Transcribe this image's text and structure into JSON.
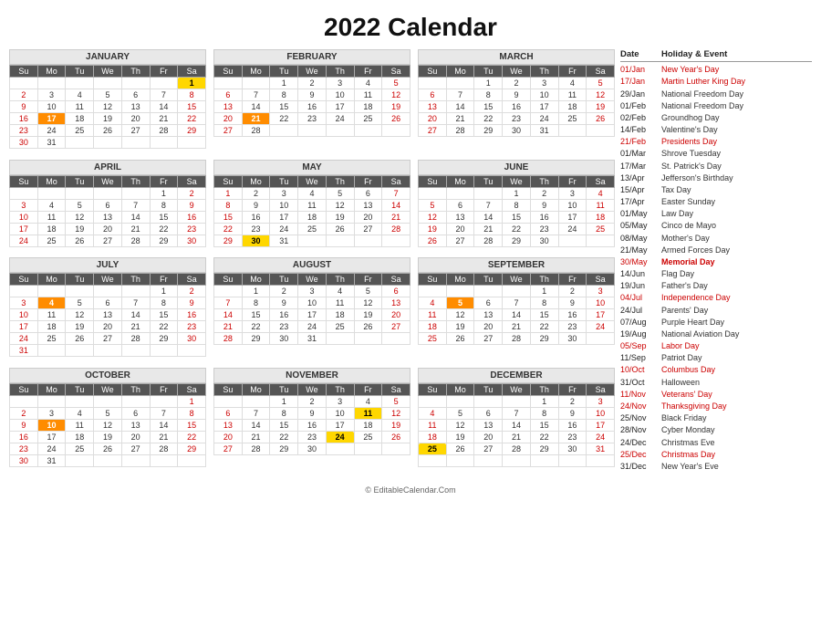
{
  "title": "2022 Calendar",
  "months": [
    {
      "name": "JANUARY",
      "headers": [
        "Su",
        "Mo",
        "Tu",
        "We",
        "Th",
        "Fr",
        "Sa"
      ],
      "weeks": [
        [
          null,
          null,
          null,
          null,
          null,
          null,
          "1h"
        ],
        [
          "2",
          "3",
          "4",
          "5",
          "6",
          "7",
          "8s"
        ],
        [
          "9",
          "10",
          "11",
          "12",
          "13",
          "14",
          "15s"
        ],
        [
          "16",
          "17o",
          "18",
          "19",
          "20",
          "21",
          "22s"
        ],
        [
          "23",
          "24",
          "25",
          "26",
          "27",
          "28",
          "29s"
        ],
        [
          "30",
          "31",
          null,
          null,
          null,
          null,
          null
        ]
      ]
    },
    {
      "name": "FEBRUARY",
      "headers": [
        "Su",
        "Mo",
        "Tu",
        "We",
        "Th",
        "Fr",
        "Sa"
      ],
      "weeks": [
        [
          null,
          null,
          "1",
          "2",
          "3",
          "4",
          "5s"
        ],
        [
          "6",
          "7",
          "8",
          "9",
          "10",
          "11",
          "12s"
        ],
        [
          "13",
          "14",
          "15",
          "16",
          "17",
          "18",
          "19s"
        ],
        [
          "20",
          "21o",
          "22",
          "23",
          "24",
          "25",
          "26s"
        ],
        [
          "27",
          "28",
          null,
          null,
          null,
          null,
          null
        ]
      ]
    },
    {
      "name": "MARCH",
      "headers": [
        "Su",
        "Mo",
        "Tu",
        "We",
        "Th",
        "Fr",
        "Sa"
      ],
      "weeks": [
        [
          null,
          null,
          "1",
          "2",
          "3",
          "4",
          "5s"
        ],
        [
          "6",
          "7",
          "8",
          "9",
          "10",
          "11",
          "12s"
        ],
        [
          "13",
          "14",
          "15",
          "16",
          "17",
          "18",
          "19s"
        ],
        [
          "20",
          "21",
          "22",
          "23",
          "24",
          "25",
          "26s"
        ],
        [
          "27",
          "28",
          "29",
          "30",
          "31",
          null,
          null
        ]
      ]
    },
    {
      "name": "APRIL",
      "headers": [
        "Su",
        "Mo",
        "Tu",
        "We",
        "Th",
        "Fr",
        "Sa"
      ],
      "weeks": [
        [
          null,
          null,
          null,
          null,
          null,
          "1",
          "2s"
        ],
        [
          "3",
          "4",
          "5",
          "6",
          "7",
          "8",
          "9s"
        ],
        [
          "10",
          "11",
          "12",
          "13",
          "14",
          "15",
          "16s"
        ],
        [
          "17",
          "18",
          "19",
          "20",
          "21",
          "22",
          "23s"
        ],
        [
          "24",
          "25",
          "26",
          "27",
          "28",
          "29",
          "30s"
        ]
      ]
    },
    {
      "name": "MAY",
      "headers": [
        "Su",
        "Mo",
        "Tu",
        "We",
        "Th",
        "Fr",
        "Sa"
      ],
      "weeks": [
        [
          "1",
          "2",
          "3",
          "4",
          "5",
          "6",
          "7s"
        ],
        [
          "8",
          "9",
          "10",
          "11",
          "12",
          "13",
          "14s"
        ],
        [
          "15",
          "16",
          "17",
          "18",
          "19",
          "20",
          "21s"
        ],
        [
          "22",
          "23",
          "24",
          "25",
          "26",
          "27",
          "28s"
        ],
        [
          "29",
          "30y",
          "31",
          null,
          null,
          null,
          null
        ]
      ]
    },
    {
      "name": "JUNE",
      "headers": [
        "Su",
        "Mo",
        "Tu",
        "We",
        "Th",
        "Fr",
        "Sa"
      ],
      "weeks": [
        [
          null,
          null,
          null,
          "1",
          "2",
          "3",
          "4s"
        ],
        [
          "5",
          "6",
          "7",
          "8",
          "9",
          "10",
          "11s"
        ],
        [
          "12",
          "13",
          "14",
          "15",
          "16",
          "17",
          "18s"
        ],
        [
          "19",
          "20",
          "21",
          "22",
          "23",
          "24",
          "25s"
        ],
        [
          "26",
          "27",
          "28",
          "29",
          "30",
          null,
          null
        ]
      ]
    },
    {
      "name": "JULY",
      "headers": [
        "Su",
        "Mo",
        "Tu",
        "We",
        "Th",
        "Fr",
        "Sa"
      ],
      "weeks": [
        [
          null,
          null,
          null,
          null,
          null,
          "1",
          "2s"
        ],
        [
          "3",
          "4o",
          "5",
          "6",
          "7",
          "8",
          "9s"
        ],
        [
          "10",
          "11",
          "12",
          "13",
          "14",
          "15",
          "16s"
        ],
        [
          "17",
          "18",
          "19",
          "20",
          "21",
          "22",
          "23s"
        ],
        [
          "24",
          "25",
          "26",
          "27",
          "28",
          "29",
          "30s"
        ],
        [
          "31",
          null,
          null,
          null,
          null,
          null,
          null
        ]
      ]
    },
    {
      "name": "AUGUST",
      "headers": [
        "Su",
        "Mo",
        "Tu",
        "We",
        "Th",
        "Fr",
        "Sa"
      ],
      "weeks": [
        [
          null,
          "1",
          "2",
          "3",
          "4",
          "5",
          "6s"
        ],
        [
          "7",
          "8",
          "9",
          "10",
          "11",
          "12",
          "13s"
        ],
        [
          "14",
          "15",
          "16",
          "17",
          "18",
          "19",
          "20s"
        ],
        [
          "21",
          "22",
          "23",
          "24",
          "25",
          "26",
          "27s"
        ],
        [
          "28",
          "29",
          "30",
          "31",
          null,
          null,
          null
        ]
      ]
    },
    {
      "name": "SEPTEMBER",
      "headers": [
        "Su",
        "Mo",
        "Tu",
        "We",
        "Th",
        "Fr",
        "Sa"
      ],
      "weeks": [
        [
          null,
          null,
          null,
          null,
          "1",
          "2",
          "3s"
        ],
        [
          "4",
          "5o",
          "6",
          "7",
          "8",
          "9",
          "10s"
        ],
        [
          "11",
          "12",
          "13",
          "14",
          "15",
          "16",
          "17s"
        ],
        [
          "18",
          "19",
          "20",
          "21",
          "22",
          "23",
          "24s"
        ],
        [
          "25",
          "26",
          "27",
          "28",
          "29",
          "30",
          null
        ]
      ]
    },
    {
      "name": "OCTOBER",
      "headers": [
        "Su",
        "Mo",
        "Tu",
        "We",
        "Th",
        "Fr",
        "Sa"
      ],
      "weeks": [
        [
          null,
          null,
          null,
          null,
          null,
          null,
          "1s"
        ],
        [
          "2",
          "3",
          "4",
          "5",
          "6",
          "7",
          "8s"
        ],
        [
          "9",
          "10o",
          "11",
          "12",
          "13",
          "14",
          "15s"
        ],
        [
          "16",
          "17",
          "18",
          "19",
          "20",
          "21",
          "22s"
        ],
        [
          "23",
          "24",
          "25",
          "26",
          "27",
          "28",
          "29s"
        ],
        [
          "30",
          "31",
          null,
          null,
          null,
          null,
          null
        ]
      ]
    },
    {
      "name": "NOVEMBER",
      "headers": [
        "Su",
        "Mo",
        "Tu",
        "We",
        "Th",
        "Fr",
        "Sa"
      ],
      "weeks": [
        [
          null,
          null,
          "1",
          "2",
          "3",
          "4",
          "5s"
        ],
        [
          "6",
          "7",
          "8",
          "9",
          "10",
          "11y",
          "12s"
        ],
        [
          "13",
          "14",
          "15",
          "16",
          "17",
          "18",
          "19s"
        ],
        [
          "20",
          "21",
          "22",
          "23",
          "24y",
          "25",
          "26s"
        ],
        [
          "27",
          "28",
          "29",
          "30",
          null,
          null,
          null
        ]
      ]
    },
    {
      "name": "DECEMBER",
      "headers": [
        "Su",
        "Mo",
        "Tu",
        "We",
        "Th",
        "Fr",
        "Sa"
      ],
      "weeks": [
        [
          null,
          null,
          null,
          null,
          "1",
          "2",
          "3s"
        ],
        [
          "4",
          "5",
          "6",
          "7",
          "8",
          "9",
          "10s"
        ],
        [
          "11",
          "12",
          "13",
          "14",
          "15",
          "16",
          "17s"
        ],
        [
          "18",
          "19",
          "20",
          "21",
          "22",
          "23",
          "24s"
        ],
        [
          "25y",
          "26",
          "27",
          "28",
          "29",
          "30",
          "31s"
        ],
        [
          null,
          null,
          null,
          null,
          null,
          null,
          null
        ]
      ]
    }
  ],
  "sidebar": {
    "header": {
      "date": "Date",
      "event": "Holiday & Event"
    },
    "items": [
      {
        "date": "01/Jan",
        "event": "New Year's Day",
        "date_class": "red",
        "event_class": "red"
      },
      {
        "date": "17/Jan",
        "event": "Martin Luther King Day",
        "date_class": "red",
        "event_class": "red"
      },
      {
        "date": "29/Jan",
        "event": "National Freedom Day",
        "date_class": "",
        "event_class": ""
      },
      {
        "date": "01/Feb",
        "event": "National Freedom Day",
        "date_class": "",
        "event_class": ""
      },
      {
        "date": "02/Feb",
        "event": "Groundhog Day",
        "date_class": "",
        "event_class": ""
      },
      {
        "date": "14/Feb",
        "event": "Valentine's Day",
        "date_class": "",
        "event_class": ""
      },
      {
        "date": "21/Feb",
        "event": "Presidents Day",
        "date_class": "red",
        "event_class": "red"
      },
      {
        "date": "01/Mar",
        "event": "Shrove Tuesday",
        "date_class": "",
        "event_class": ""
      },
      {
        "date": "17/Mar",
        "event": "St. Patrick's Day",
        "date_class": "",
        "event_class": ""
      },
      {
        "date": "13/Apr",
        "event": "Jefferson's Birthday",
        "date_class": "",
        "event_class": ""
      },
      {
        "date": "15/Apr",
        "event": "Tax Day",
        "date_class": "",
        "event_class": ""
      },
      {
        "date": "17/Apr",
        "event": "Easter Sunday",
        "date_class": "",
        "event_class": ""
      },
      {
        "date": "01/May",
        "event": "Law Day",
        "date_class": "",
        "event_class": ""
      },
      {
        "date": "05/May",
        "event": "Cinco de Mayo",
        "date_class": "",
        "event_class": ""
      },
      {
        "date": "08/May",
        "event": "Mother's Day",
        "date_class": "",
        "event_class": ""
      },
      {
        "date": "21/May",
        "event": "Armed Forces Day",
        "date_class": "",
        "event_class": ""
      },
      {
        "date": "30/May",
        "event": "Memorial Day",
        "date_class": "red",
        "event_class": "bold-red"
      },
      {
        "date": "14/Jun",
        "event": "Flag Day",
        "date_class": "",
        "event_class": ""
      },
      {
        "date": "19/Jun",
        "event": "Father's Day",
        "date_class": "",
        "event_class": ""
      },
      {
        "date": "04/Jul",
        "event": "Independence Day",
        "date_class": "red",
        "event_class": "red"
      },
      {
        "date": "24/Jul",
        "event": "Parents' Day",
        "date_class": "",
        "event_class": ""
      },
      {
        "date": "07/Aug",
        "event": "Purple Heart Day",
        "date_class": "",
        "event_class": ""
      },
      {
        "date": "19/Aug",
        "event": "National Aviation Day",
        "date_class": "",
        "event_class": ""
      },
      {
        "date": "05/Sep",
        "event": "Labor Day",
        "date_class": "red",
        "event_class": "red"
      },
      {
        "date": "11/Sep",
        "event": "Patriot Day",
        "date_class": "",
        "event_class": ""
      },
      {
        "date": "10/Oct",
        "event": "Columbus Day",
        "date_class": "red",
        "event_class": "red"
      },
      {
        "date": "31/Oct",
        "event": "Halloween",
        "date_class": "",
        "event_class": ""
      },
      {
        "date": "11/Nov",
        "event": "Veterans' Day",
        "date_class": "red",
        "event_class": "red"
      },
      {
        "date": "24/Nov",
        "event": "Thanksgiving Day",
        "date_class": "red",
        "event_class": "red"
      },
      {
        "date": "25/Nov",
        "event": "Black Friday",
        "date_class": "",
        "event_class": ""
      },
      {
        "date": "28/Nov",
        "event": "Cyber Monday",
        "date_class": "",
        "event_class": ""
      },
      {
        "date": "24/Dec",
        "event": "Christmas Eve",
        "date_class": "",
        "event_class": ""
      },
      {
        "date": "25/Dec",
        "event": "Christmas Day",
        "date_class": "red",
        "event_class": "red"
      },
      {
        "date": "31/Dec",
        "event": "New Year's Eve",
        "date_class": "",
        "event_class": ""
      }
    ]
  },
  "footer": "© EditableCalendar.Com"
}
